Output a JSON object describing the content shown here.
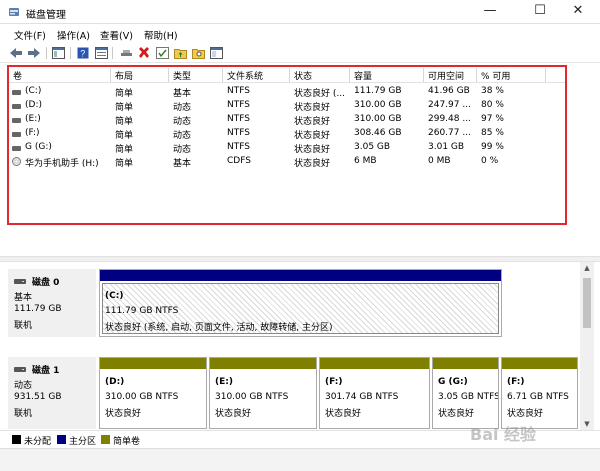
{
  "window": {
    "title": "磁盘管理",
    "min": "—",
    "max": "☐",
    "close": "✕"
  },
  "menu": [
    "文件(F)",
    "操作(A)",
    "查看(V)",
    "帮助(H)"
  ],
  "volume_table": {
    "headers": [
      "卷",
      "布局",
      "类型",
      "文件系统",
      "状态",
      "容量",
      "可用空间",
      "% 可用"
    ],
    "rows": [
      {
        "icon": "drive-icon",
        "vol": "(C:)",
        "layout": "简单",
        "type": "基本",
        "fs": "NTFS",
        "status": "状态良好 (...",
        "capacity": "111.79 GB",
        "free": "41.96 GB",
        "pct": "38 %"
      },
      {
        "icon": "drive-icon",
        "vol": "(D:)",
        "layout": "简单",
        "type": "动态",
        "fs": "NTFS",
        "status": "状态良好",
        "capacity": "310.00 GB",
        "free": "247.97 ...",
        "pct": "80 %"
      },
      {
        "icon": "drive-icon",
        "vol": "(E:)",
        "layout": "简单",
        "type": "动态",
        "fs": "NTFS",
        "status": "状态良好",
        "capacity": "310.00 GB",
        "free": "299.48 ...",
        "pct": "97 %"
      },
      {
        "icon": "drive-icon",
        "vol": "(F:)",
        "layout": "简单",
        "type": "动态",
        "fs": "NTFS",
        "status": "状态良好",
        "capacity": "308.46 GB",
        "free": "260.77 ...",
        "pct": "85 %"
      },
      {
        "icon": "drive-icon",
        "vol": "G (G:)",
        "layout": "简单",
        "type": "动态",
        "fs": "NTFS",
        "status": "状态良好",
        "capacity": "3.05 GB",
        "free": "3.01 GB",
        "pct": "99 %"
      },
      {
        "icon": "cd-icon",
        "vol": "华为手机助手 (H:)",
        "layout": "简单",
        "type": "基本",
        "fs": "CDFS",
        "status": "状态良好",
        "capacity": "6 MB",
        "free": "0 MB",
        "pct": "0 %"
      }
    ]
  },
  "disks": [
    {
      "name": "磁盘 0",
      "type": "基本",
      "size": "111.79 GB",
      "status": "联机",
      "partitions": [
        {
          "label": "(C:)",
          "size": "111.79 GB NTFS",
          "status": "状态良好 (系统, 启动, 页面文件, 活动, 故障转储, 主分区)"
        }
      ]
    },
    {
      "name": "磁盘 1",
      "type": "动态",
      "size": "931.51 GB",
      "status": "联机",
      "partitions": [
        {
          "label": "(D:)",
          "size": "310.00 GB NTFS",
          "status": "状态良好"
        },
        {
          "label": "(E:)",
          "size": "310.00 GB NTFS",
          "status": "状态良好"
        },
        {
          "label": "(F:)",
          "size": "301.74 GB NTFS",
          "status": "状态良好"
        },
        {
          "label": "G (G:)",
          "size": "3.05 GB NTFS",
          "status": "状态良好"
        },
        {
          "label": "(F:)",
          "size": "6.71 GB NTFS",
          "status": "状态良好"
        }
      ]
    }
  ],
  "legend": [
    "未分配",
    "主分区",
    "简单卷"
  ],
  "colors": {
    "unallocated": "#000000",
    "primary": "#000080",
    "simple": "#808000",
    "highlight": "#e3262f"
  },
  "watermark": "Bai 经验"
}
